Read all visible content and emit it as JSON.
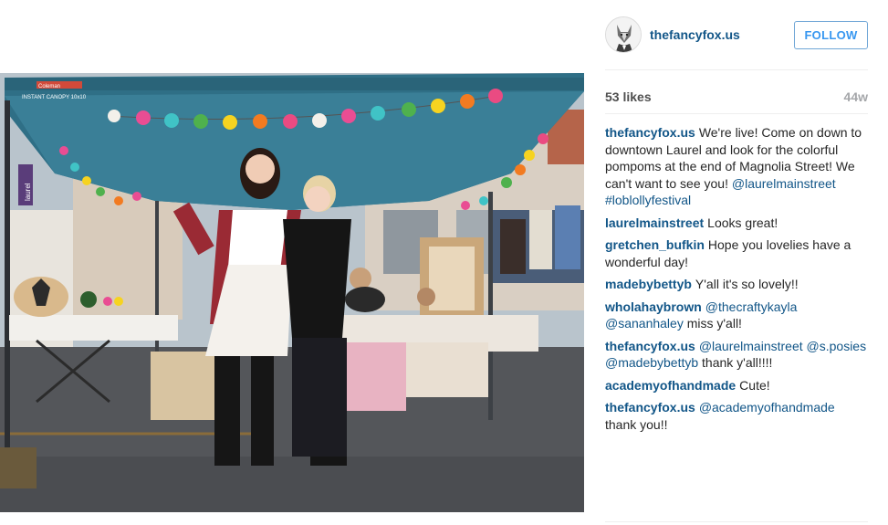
{
  "post": {
    "username": "thefancyfox.us",
    "follow_label": "FOLLOW",
    "likes": "53 likes",
    "time_ago": "44w"
  },
  "comments": [
    {
      "author": "thefancyfox.us",
      "parts": [
        {
          "t": "We're live! Come on down to downtown Laurel and look for the colorful pompoms at the end of Magnolia Street! We can't want to see you! ",
          "m": false
        },
        {
          "t": "@laurelmainstreet",
          "m": true
        },
        {
          "t": " ",
          "m": false
        },
        {
          "t": "#loblollyfestival",
          "m": true
        }
      ]
    },
    {
      "author": "laurelmainstreet",
      "parts": [
        {
          "t": "Looks great!",
          "m": false
        }
      ]
    },
    {
      "author": "gretchen_bufkin",
      "parts": [
        {
          "t": "Hope you lovelies have a wonderful day!",
          "m": false
        }
      ]
    },
    {
      "author": "madebybettyb",
      "parts": [
        {
          "t": "Y'all it's so lovely!!",
          "m": false
        }
      ]
    },
    {
      "author": "wholahaybrown",
      "parts": [
        {
          "t": "@thecraftykayla",
          "m": true
        },
        {
          "t": " ",
          "m": false
        },
        {
          "t": "@sananhaley",
          "m": true
        },
        {
          "t": " miss y'all!",
          "m": false
        }
      ]
    },
    {
      "author": "thefancyfox.us",
      "parts": [
        {
          "t": "@laurelmainstreet",
          "m": true
        },
        {
          "t": " ",
          "m": false
        },
        {
          "t": "@s.posies",
          "m": true
        },
        {
          "t": " ",
          "m": false
        },
        {
          "t": "@madebybettyb",
          "m": true
        },
        {
          "t": " thank y'all!!!!",
          "m": false
        }
      ]
    },
    {
      "author": "academyofhandmade",
      "parts": [
        {
          "t": "Cute!",
          "m": false
        }
      ]
    },
    {
      "author": "thefancyfox.us",
      "parts": [
        {
          "t": "@academyofhandmade",
          "m": true
        },
        {
          "t": " thank you!!",
          "m": false
        }
      ]
    }
  ],
  "photo_text": {
    "canopy_brand": "Coleman",
    "canopy_model": "INSTANT CANOPY 10x10",
    "banner": "laurel"
  },
  "colors": {
    "link": "#125688",
    "follow": "#3897f0",
    "muted": "#a5a7aa",
    "canopy": "#2f6f86"
  }
}
